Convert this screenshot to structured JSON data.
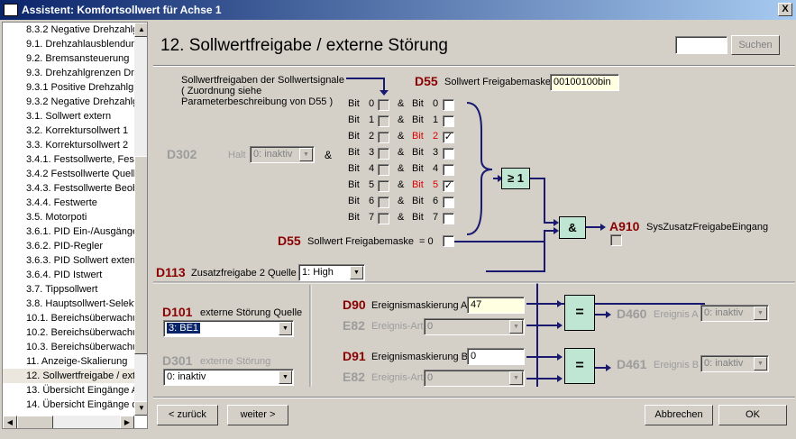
{
  "window": {
    "title": "Assistent: Komfortsollwert für Achse 1",
    "close_label": "X"
  },
  "tree": {
    "items": [
      "8.3.2 Negative Drehzahlg",
      "9.1. Drehzahlausblendun",
      "9.2. Bremsansteuerung",
      "9.3. Drehzahlgrenzen Dre",
      "9.3.1 Positive Drehzahlgr",
      "9.3.2 Negative Drehzahlg",
      "3.1. Sollwert extern",
      "3.2. Korrektursollwert 1",
      "3.3. Korrektursollwert 2",
      "3.4.1. Festsollwerte, Fest",
      "3.4.2 Festsollwerte Quelle",
      "3.4.3. Festsollwerte Beob",
      "3.4.4. Festwerte",
      "3.5. Motorpoti",
      "3.6.1. PID Ein-/Ausgänge",
      "3.6.2. PID-Regler",
      "3.6.3. PID Sollwert extern",
      "3.6.4. PID Istwert",
      "3.7. Tippsollwert",
      "3.8. Hauptsollwert-Selekt",
      "10.1. Bereichsüberwachu",
      "10.2. Bereichsüberwachu",
      "10.3. Bereichsüberwachu",
      "11. Anzeige-Skalierung",
      "12. Sollwertfreigabe / ext",
      "13. Übersicht Eingänge A",
      "14. Übersicht Eingänge d"
    ],
    "selected_index": 24
  },
  "page": {
    "title": "12. Sollwertfreigabe / externe Störung"
  },
  "search": {
    "value": "",
    "button_label": "Suchen"
  },
  "top": {
    "note_line1": "Sollwertfreigaben der Sollwertsignale",
    "note_line2": "( Zuordnung siehe",
    "note_line3": "Parameterbeschreibung von D55 )",
    "d55_code": "D55",
    "d55_label": "Sollwert Freigabemaske",
    "d55_value": "00100100bin",
    "d302_code": "D302",
    "d302_label": "Halt",
    "d302_value": "0: inaktiv",
    "and_symbol": "&",
    "bit_word": "Bit",
    "bits": [
      {
        "n": "0",
        "mask": false
      },
      {
        "n": "1",
        "mask": false
      },
      {
        "n": "2",
        "mask": true
      },
      {
        "n": "3",
        "mask": false
      },
      {
        "n": "4",
        "mask": false
      },
      {
        "n": "5",
        "mask": true
      },
      {
        "n": "6",
        "mask": false
      },
      {
        "n": "7",
        "mask": false
      }
    ],
    "check_mark": "✓",
    "or_gate_label": "≥ 1",
    "and_gate_label": "&",
    "d55b_code": "D55",
    "d55b_label": "Sollwert Freigabemaske",
    "d55b_eq": "= 0",
    "a910_code": "A910",
    "a910_label": "SysZusatzFreigabeEingang",
    "d113_code": "D113",
    "d113_label": "Zusatzfreigabe 2 Quelle",
    "d113_value": "1: High"
  },
  "bottom": {
    "d101_code": "D101",
    "d101_label": "externe Störung Quelle",
    "d101_value": "3: BE1",
    "d301_code": "D301",
    "d301_label": "externe Störung",
    "d301_value": "0: inaktiv",
    "d90_code": "D90",
    "d90_label": "Ereignismaskierung A",
    "d90_value": "47",
    "e82a_code": "E82",
    "e82a_label": "Ereignis-Art",
    "e82a_value": "0",
    "d91_code": "D91",
    "d91_label": "Ereignismaskierung B",
    "d91_value": "0",
    "e82b_code": "E82",
    "e82b_label": "Ereignis-Art",
    "e82b_value": "0",
    "eq_gate_label": "=",
    "d460_code": "D460",
    "d460_label": "Ereignis A",
    "d460_value": "0: inaktiv",
    "d461_code": "D461",
    "d461_label": "Ereignis B",
    "d461_value": "0: inaktiv"
  },
  "nav": {
    "back": "< zurück",
    "next": "weiter >",
    "cancel": "Abbrechen",
    "ok": "OK"
  }
}
